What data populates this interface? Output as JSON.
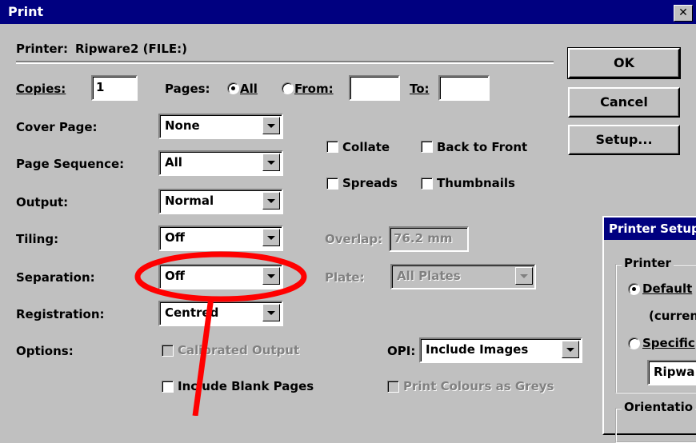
{
  "window": {
    "title": "Print",
    "close_icon": "close-icon"
  },
  "printer": {
    "label": "Printer:",
    "value": "Ripware2 (FILE:)"
  },
  "buttons": {
    "ok": "OK",
    "cancel": "Cancel",
    "setup": "Setup..."
  },
  "copies": {
    "label": "Copies:",
    "value": "1"
  },
  "pages": {
    "label": "Pages:",
    "all": "All",
    "from": "From:",
    "to": "To:",
    "from_value": "",
    "to_value": ""
  },
  "rows": {
    "cover_page": {
      "label": "Cover Page:",
      "value": "None"
    },
    "page_sequence": {
      "label": "Page Sequence:",
      "value": "All"
    },
    "output": {
      "label": "Output:",
      "value": "Normal"
    },
    "tiling": {
      "label": "Tiling:",
      "value": "Off"
    },
    "separation": {
      "label": "Separation:",
      "value": "Off"
    },
    "registration": {
      "label": "Registration:",
      "value": "Centred"
    },
    "options": {
      "label": "Options:"
    }
  },
  "checkboxes": {
    "collate": "Collate",
    "back_to_front": "Back to Front",
    "spreads": "Spreads",
    "thumbnails": "Thumbnails",
    "calibrated_output": "Calibrated Output",
    "include_blank_pages": "Include Blank Pages",
    "print_colours_as_greys": "Print Colours as Greys"
  },
  "overlap": {
    "label": "Overlap:",
    "value": "76.2 mm"
  },
  "plate": {
    "label": "Plate:",
    "value": "All Plates"
  },
  "opi": {
    "label": "OPI:",
    "value": "Include Images"
  },
  "printer_setup": {
    "title": "Printer Setup",
    "group_label": "Printer",
    "default_label": "Default",
    "current_label": "(curren",
    "specific_label": "Specific",
    "specific_value": "Ripwa",
    "orientation_label": "Orientatio"
  },
  "annotation": {
    "color": "#ff0000"
  },
  "colors": {
    "titlebar": "#000080",
    "face": "#c0c0c0"
  }
}
